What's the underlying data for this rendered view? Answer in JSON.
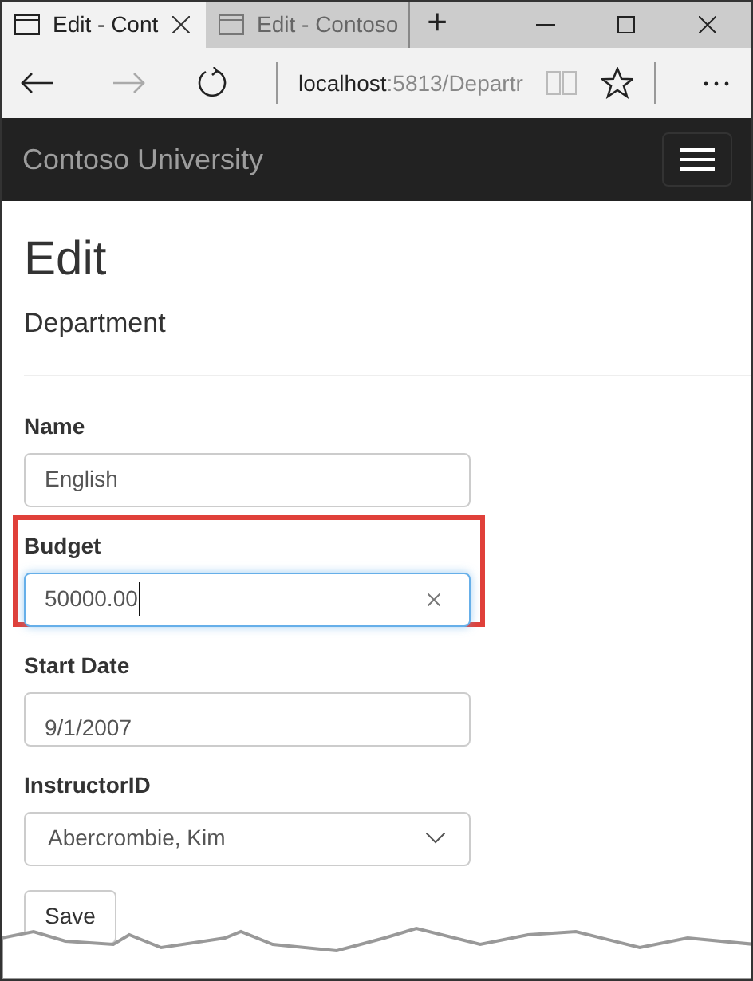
{
  "browser": {
    "tabs": [
      {
        "title": "Edit - Cont",
        "selected": true,
        "closable": true
      },
      {
        "title": "Edit - Contoso",
        "selected": false,
        "closable": false
      }
    ],
    "new_tab": "+",
    "address": {
      "host": "localhost",
      "rest": ":5813/Departr"
    }
  },
  "navbar": {
    "brand": "Contoso University"
  },
  "page": {
    "title": "Edit",
    "subtitle": "Department"
  },
  "fields": [
    {
      "kind": "text",
      "label": "Name",
      "value": "English",
      "focused": false,
      "highlighted": false
    },
    {
      "kind": "text",
      "label": "Budget",
      "value": "50000.00",
      "focused": true,
      "highlighted": true
    },
    {
      "kind": "date",
      "label": "Start Date",
      "value": "9/1/2007",
      "focused": false,
      "highlighted": false
    },
    {
      "kind": "select",
      "label": "InstructorID",
      "value": "Abercrombie, Kim",
      "focused": false,
      "highlighted": false
    }
  ],
  "save_button": "Save"
}
